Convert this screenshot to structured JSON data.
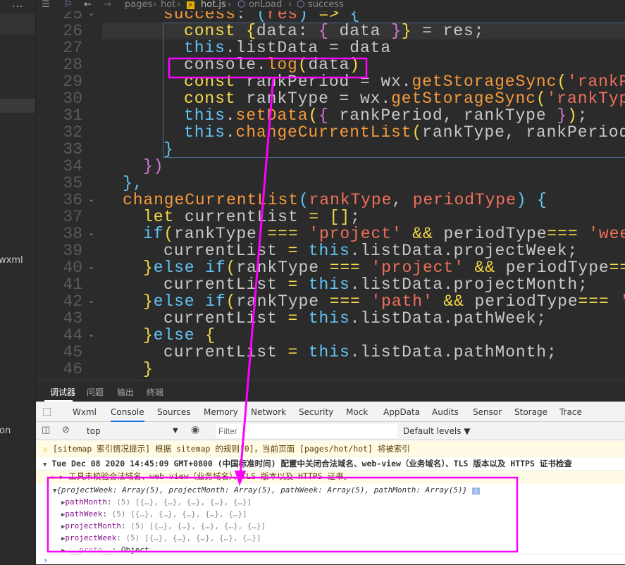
{
  "sidebar": {
    "more_label": "...",
    "items": [
      "wxml",
      "on"
    ]
  },
  "breadcrumb": {
    "items": [
      "pages",
      "hot",
      "hot.js",
      "onLoad",
      "success"
    ]
  },
  "editor": {
    "lines": [
      {
        "n": 25,
        "fold": true,
        "ind": 4,
        "t": [
          [
            "fn",
            "success"
          ],
          [
            "pl",
            ": "
          ],
          [
            "cy",
            "("
          ],
          [
            "pa",
            "res"
          ],
          [
            "cy",
            ")"
          ],
          [
            "op",
            " => "
          ],
          [
            "cy",
            "{"
          ]
        ]
      },
      {
        "n": 26,
        "ind": 6,
        "t": [
          [
            "kw",
            "const "
          ],
          [
            "kw",
            "{"
          ],
          [
            "pl",
            "data: "
          ],
          [
            "pk",
            "{"
          ],
          [
            "pl",
            " data "
          ],
          [
            "pk",
            "}"
          ],
          [
            "kw",
            "}"
          ],
          [
            "pl",
            " = res;"
          ]
        ]
      },
      {
        "n": 27,
        "ind": 6,
        "t": [
          [
            "th",
            "this"
          ],
          [
            "pl",
            ".listData = data"
          ]
        ]
      },
      {
        "n": 28,
        "ind": 6,
        "t": [
          [
            "pl",
            "console."
          ],
          [
            "fn",
            "log"
          ],
          [
            "kw",
            "("
          ],
          [
            "pl",
            "data"
          ],
          [
            "kw",
            ")"
          ]
        ]
      },
      {
        "n": 29,
        "ind": 6,
        "t": [
          [
            "kw",
            "const "
          ],
          [
            "pl",
            "rankPeriod = wx."
          ],
          [
            "fn",
            "getStorageSync"
          ],
          [
            "kw",
            "("
          ],
          [
            "st",
            "'rankPe"
          ]
        ]
      },
      {
        "n": 30,
        "ind": 6,
        "t": [
          [
            "kw",
            "const "
          ],
          [
            "pl",
            "rankType = wx."
          ],
          [
            "fn",
            "getStorageSync"
          ],
          [
            "kw",
            "("
          ],
          [
            "st",
            "'rankType"
          ]
        ]
      },
      {
        "n": 31,
        "ind": 6,
        "t": [
          [
            "th",
            "this"
          ],
          [
            "pl",
            "."
          ],
          [
            "fn",
            "setData"
          ],
          [
            "kw",
            "("
          ],
          [
            "pk",
            "{"
          ],
          [
            "pl",
            " rankPeriod, rankType "
          ],
          [
            "pk",
            "}"
          ],
          [
            "kw",
            ")"
          ],
          [
            "pl",
            ";"
          ]
        ]
      },
      {
        "n": 32,
        "ind": 6,
        "t": [
          [
            "th",
            "this"
          ],
          [
            "pl",
            "."
          ],
          [
            "fn",
            "changeCurrentList"
          ],
          [
            "kw",
            "("
          ],
          [
            "pl",
            "rankType, rankPeriod"
          ],
          [
            "kw",
            ")"
          ]
        ]
      },
      {
        "n": 33,
        "ind": 4,
        "t": [
          [
            "cy",
            "}"
          ]
        ]
      },
      {
        "n": 34,
        "ind": 2,
        "t": [
          [
            "pk",
            "})"
          ]
        ]
      },
      {
        "n": 35,
        "ind": 0,
        "t": [
          [
            "cy",
            "},"
          ]
        ]
      },
      {
        "n": 36,
        "fold": true,
        "ind": 0,
        "t": [
          [
            "fn",
            "changeCurrentList"
          ],
          [
            "cy",
            "("
          ],
          [
            "pa",
            "rankType"
          ],
          [
            "pl",
            ", "
          ],
          [
            "pa",
            "periodType"
          ],
          [
            "cy",
            ")"
          ],
          [
            "pl",
            " "
          ],
          [
            "cy",
            "{"
          ]
        ]
      },
      {
        "n": 37,
        "ind": 2,
        "t": [
          [
            "kw",
            "let "
          ],
          [
            "pl",
            "currentList "
          ],
          [
            "op",
            "= "
          ],
          [
            "kw",
            "[]"
          ],
          [
            "pl",
            ";"
          ]
        ]
      },
      {
        "n": 38,
        "fold": true,
        "ind": 2,
        "t": [
          [
            "th",
            "if"
          ],
          [
            "kw",
            "("
          ],
          [
            "pl",
            "rankType "
          ],
          [
            "op",
            "=== "
          ],
          [
            "st",
            "'project'"
          ],
          [
            "op",
            " && "
          ],
          [
            "pl",
            "periodType"
          ],
          [
            "op",
            "=== "
          ],
          [
            "st",
            "'week"
          ]
        ]
      },
      {
        "n": 39,
        "ind": 4,
        "t": [
          [
            "pl",
            "currentList "
          ],
          [
            "op",
            "= "
          ],
          [
            "th",
            "this"
          ],
          [
            "pl",
            ".listData.projectWeek;"
          ]
        ]
      },
      {
        "n": 40,
        "fold": true,
        "ind": 2,
        "t": [
          [
            "kw",
            "}"
          ],
          [
            "th",
            "else if"
          ],
          [
            "kw",
            "("
          ],
          [
            "pl",
            "rankType "
          ],
          [
            "op",
            "=== "
          ],
          [
            "st",
            "'project'"
          ],
          [
            "op",
            " && "
          ],
          [
            "pl",
            "periodType"
          ],
          [
            "op",
            "==="
          ]
        ]
      },
      {
        "n": 41,
        "ind": 4,
        "t": [
          [
            "pl",
            "currentList "
          ],
          [
            "op",
            "= "
          ],
          [
            "th",
            "this"
          ],
          [
            "pl",
            ".listData.projectMonth;"
          ]
        ]
      },
      {
        "n": 42,
        "fold": true,
        "ind": 2,
        "t": [
          [
            "kw",
            "}"
          ],
          [
            "th",
            "else if"
          ],
          [
            "kw",
            "("
          ],
          [
            "pl",
            "rankType "
          ],
          [
            "op",
            "=== "
          ],
          [
            "st",
            "'path'"
          ],
          [
            "op",
            " && "
          ],
          [
            "pl",
            "periodType"
          ],
          [
            "op",
            "=== "
          ],
          [
            "st",
            "'w"
          ]
        ]
      },
      {
        "n": 43,
        "ind": 4,
        "t": [
          [
            "pl",
            "currentList "
          ],
          [
            "op",
            "= "
          ],
          [
            "th",
            "this"
          ],
          [
            "pl",
            ".listData.pathWeek;"
          ]
        ]
      },
      {
        "n": 44,
        "fold": true,
        "ind": 2,
        "t": [
          [
            "kw",
            "}"
          ],
          [
            "th",
            "else "
          ],
          [
            "kw",
            "{"
          ]
        ]
      },
      {
        "n": 45,
        "ind": 4,
        "t": [
          [
            "pl",
            "currentList "
          ],
          [
            "op",
            "= "
          ],
          [
            "th",
            "this"
          ],
          [
            "pl",
            ".listData.pathMonth;"
          ]
        ]
      },
      {
        "n": 46,
        "ind": 2,
        "t": [
          [
            "kw",
            "}"
          ]
        ]
      }
    ]
  },
  "devtools": {
    "panels": [
      "调试器",
      "问题",
      "输出",
      "终端"
    ],
    "tabs": [
      "Wxml",
      "Console",
      "Sources",
      "Memory",
      "Network",
      "Security",
      "Mock",
      "AppData",
      "Audits",
      "Sensor",
      "Storage",
      "Trace"
    ],
    "active_tab": "Console",
    "context": "top",
    "filter_placeholder": "Filter",
    "levels": "Default levels ▼",
    "messages": {
      "sitemap": "[sitemap 索引情况提示] 根据 sitemap 的规则[0]，当前页面 [pages/hot/hot] 将被索引",
      "group": "Tue Dec 08 2020 14:45:09 GMT+0800 (中国标准时间) 配置中关闭合法域名、web-view（业务域名）、TLS 版本以及 HTTPS 证书检查",
      "group_child": "工具未校验合法域名、web-view（业务域名）、TLS 版本以及 HTTPS 证书。",
      "object_summary": "{projectWeek: Array(5), projectMonth: Array(5), pathWeek: Array(5), pathMonth: Array(5)}",
      "props": [
        {
          "key": "pathMonth",
          "value": "(5) [{…}, {…}, {…}, {…}, {…}]"
        },
        {
          "key": "pathWeek",
          "value": "(5) [{…}, {…}, {…}, {…}, {…}]"
        },
        {
          "key": "projectMonth",
          "value": "(5) [{…}, {…}, {…}, {…}, {…}]"
        },
        {
          "key": "projectWeek",
          "value": "(5) [{…}, {…}, {…}, {…}, {…}]"
        }
      ],
      "proto_key": "__proto__",
      "proto_value": ": Object"
    },
    "prompt": "›"
  },
  "colors": {
    "annotation": "#ff00ff",
    "tab_accent": "#1a73e8"
  }
}
